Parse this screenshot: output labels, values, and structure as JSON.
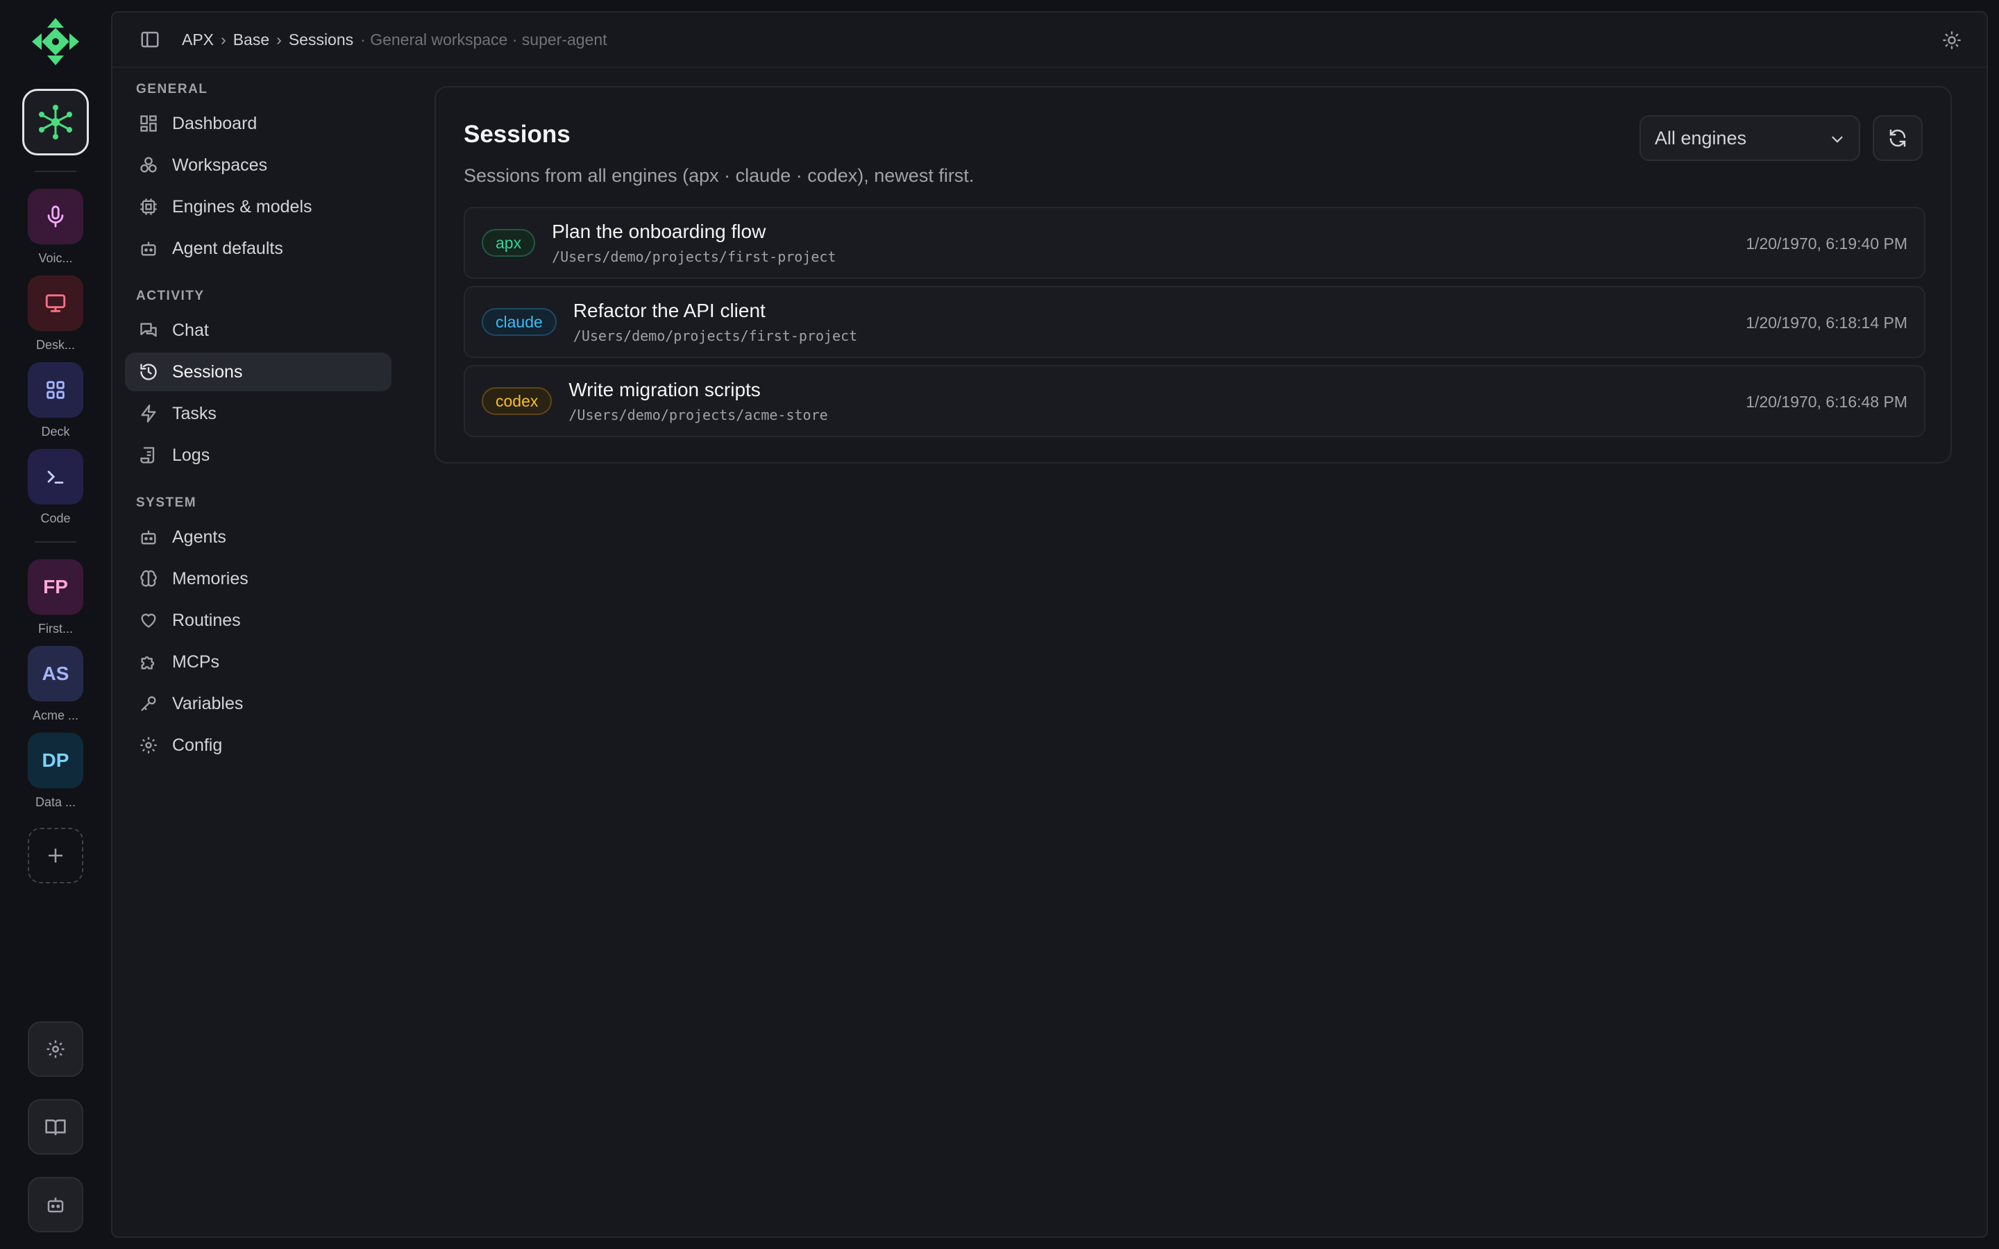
{
  "rail": {
    "apps": [
      {
        "label": "Voic...",
        "bg": "#3a1838",
        "color": "#f0abfc",
        "icon": "microphone-icon"
      },
      {
        "label": "Desk...",
        "bg": "#3b1820",
        "color": "#fb7185",
        "icon": "monitor-icon"
      },
      {
        "label": "Deck",
        "bg": "#23234a",
        "color": "#a5b4fc",
        "icon": "grid-icon"
      },
      {
        "label": "Code",
        "bg": "#23204a",
        "color": "#c7d2fe",
        "icon": "terminal-icon"
      }
    ],
    "workspaces": [
      {
        "initials": "FP",
        "label": "First...",
        "bg": "#3a1838",
        "color": "#f9a8d4"
      },
      {
        "initials": "AS",
        "label": "Acme ...",
        "bg": "#252a4a",
        "color": "#a5b4fc"
      },
      {
        "initials": "DP",
        "label": "Data ...",
        "bg": "#0f2a3a",
        "color": "#7dd3fc"
      }
    ]
  },
  "breadcrumb": {
    "items": [
      "APX",
      "Base",
      "Sessions"
    ],
    "separator": "›",
    "context": "· General workspace · super-agent"
  },
  "sidebar": {
    "general": {
      "title": "GENERAL",
      "items": [
        "Dashboard",
        "Workspaces",
        "Engines & models",
        "Agent defaults"
      ]
    },
    "activity": {
      "title": "ACTIVITY",
      "items": [
        "Chat",
        "Sessions",
        "Tasks",
        "Logs"
      ]
    },
    "system": {
      "title": "SYSTEM",
      "items": [
        "Agents",
        "Memories",
        "Routines",
        "MCPs",
        "Variables",
        "Config"
      ]
    }
  },
  "main": {
    "title": "Sessions",
    "subtitle": "Sessions from all engines (apx · claude · codex), newest first.",
    "engine_filter": "All engines",
    "sessions": [
      {
        "engine": "apx",
        "title": "Plan the onboarding flow",
        "path": "/Users/demo/projects/first-project",
        "time": "1/20/1970, 6:19:40 PM"
      },
      {
        "engine": "claude",
        "title": "Refactor the API client",
        "path": "/Users/demo/projects/first-project",
        "time": "1/20/1970, 6:18:14 PM"
      },
      {
        "engine": "codex",
        "title": "Write migration scripts",
        "path": "/Users/demo/projects/acme-store",
        "time": "1/20/1970, 6:16:48 PM"
      }
    ]
  },
  "colors": {
    "accent_green": "#4ade80",
    "apx": "#34d399",
    "claude": "#38bdf8",
    "codex": "#fbbf24"
  }
}
